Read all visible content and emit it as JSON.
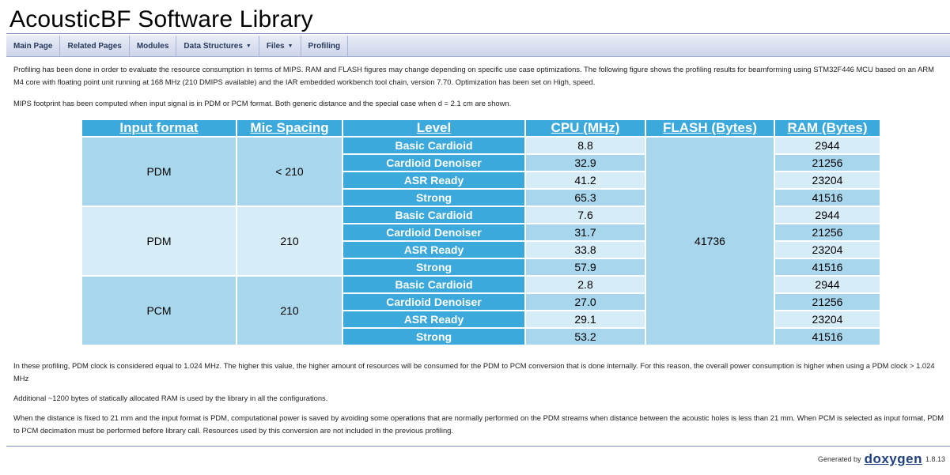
{
  "header": {
    "title": "AcousticBF Software Library"
  },
  "nav": {
    "items": [
      {
        "label": "Main Page"
      },
      {
        "label": "Related Pages"
      },
      {
        "label": "Modules"
      },
      {
        "label": "Data Structures",
        "caret": "▼"
      },
      {
        "label": "Files",
        "caret": "▼"
      },
      {
        "label": "Profiling"
      }
    ]
  },
  "intro": {
    "p1": "Profiling has been done in order to evaluate the resource consumption in terms of MIPS. RAM and FLASH figures may change depending on specific use case optimizations. The following figure shows the profiling results for beamforming using STM32F446 MCU based on an ARM M4 core with floating point unit running at 168 MHz (210 DMIPS available) and the IAR embedded workbench tool chain, version 7.70. Optimization has been set on High, speed.",
    "p2": "MIPS footprint has been computed when input signal is in PDM or PCM format. Both generic distance and the special case when d = 2.1 cm are shown."
  },
  "table": {
    "headers": [
      "Input format",
      "Mic Spacing",
      "Level",
      "CPU (MHz)",
      "FLASH (Bytes)",
      "RAM (Bytes)"
    ],
    "flash": "41736",
    "groups": [
      {
        "format": "PDM",
        "spacing": "< 210",
        "rows": [
          {
            "level": "Basic Cardioid",
            "cpu": "8.8",
            "ram": "2944"
          },
          {
            "level": "Cardioid Denoiser",
            "cpu": "32.9",
            "ram": "21256"
          },
          {
            "level": "ASR Ready",
            "cpu": "41.2",
            "ram": "23204"
          },
          {
            "level": "Strong",
            "cpu": "65.3",
            "ram": "41516"
          }
        ]
      },
      {
        "format": "PDM",
        "spacing": "210",
        "rows": [
          {
            "level": "Basic Cardioid",
            "cpu": "7.6",
            "ram": "2944"
          },
          {
            "level": "Cardioid Denoiser",
            "cpu": "31.7",
            "ram": "21256"
          },
          {
            "level": "ASR Ready",
            "cpu": "33.8",
            "ram": "23204"
          },
          {
            "level": "Strong",
            "cpu": "57.9",
            "ram": "41516"
          }
        ]
      },
      {
        "format": "PCM",
        "spacing": "210",
        "rows": [
          {
            "level": "Basic Cardioid",
            "cpu": "2.8",
            "ram": "2944"
          },
          {
            "level": "Cardioid Denoiser",
            "cpu": "27.0",
            "ram": "21256"
          },
          {
            "level": "ASR Ready",
            "cpu": "29.1",
            "ram": "23204"
          },
          {
            "level": "Strong",
            "cpu": "53.2",
            "ram": "41516"
          }
        ]
      }
    ]
  },
  "notes": {
    "p3": "In these profiling, PDM clock is considered equal to 1.024 MHz. The higher this value, the higher amount of resources will be consumed for the PDM to PCM conversion that is done internally. For this reason, the overall power consumption is higher when using a PDM clock > 1.024 MHz",
    "p4": "Additional ~1200 bytes of statically allocated RAM is used by the library in all the configurations.",
    "p5": "When the distance is fixed to 21 mm and the input format is PDM, computational power is saved by avoiding some operations that are normally performed on the PDM streams when distance between the acoustic holes is less than 21 mm. When PCM is selected as input format, PDM to PCM decimation must be performed before library call. Resources used by this conversion are not included in the previous profiling."
  },
  "footer": {
    "generated_by": "Generated by",
    "logo_text": "doxygen",
    "version": "1.8.13"
  }
}
